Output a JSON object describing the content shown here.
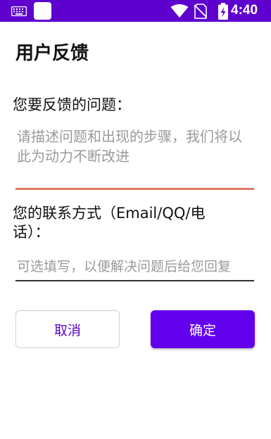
{
  "status_bar": {
    "time": "4:40",
    "icons": [
      "keyboard-icon",
      "notification-icon",
      "wifi-icon",
      "no-sim-icon",
      "battery-charging-icon"
    ],
    "background": "#5e00ce"
  },
  "page": {
    "title": "用户反馈"
  },
  "feedback": {
    "label": "您要反馈的问题：",
    "placeholder": "请描述问题和出现的步骤，我们将以此为动力不断改进",
    "value": "",
    "underline_color": "#e27a63"
  },
  "contact": {
    "label_line1": "您的联系方式（Email/QQ/电",
    "label_line2": "话）：",
    "placeholder": "可选填写，以便解决问题后给您回复",
    "value": ""
  },
  "buttons": {
    "cancel_label": "取消",
    "confirm_label": "确定",
    "accent": "#6200ee"
  }
}
